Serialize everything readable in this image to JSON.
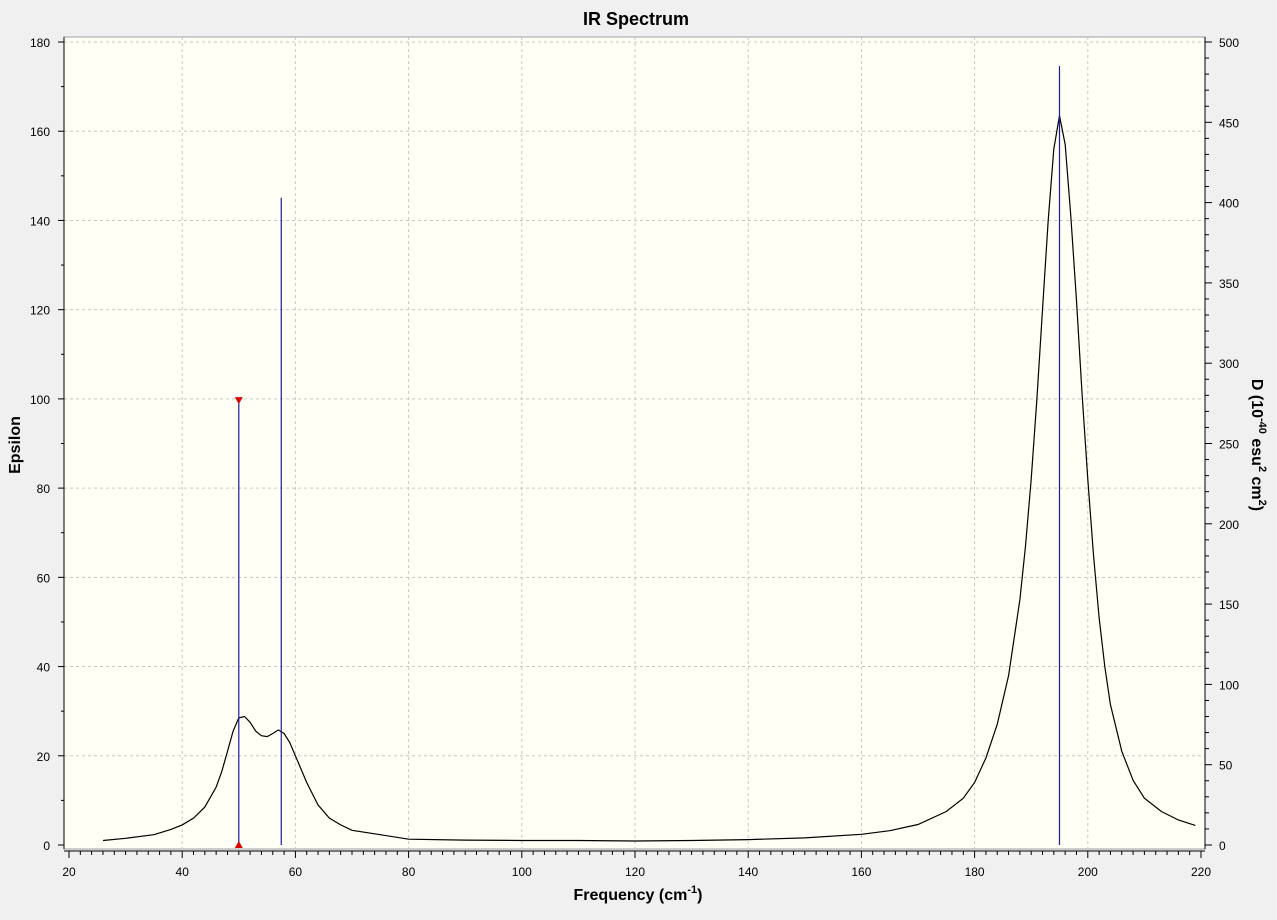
{
  "chart_data": {
    "type": "line",
    "title": "IR Spectrum",
    "xlabel": "Frequency (cm",
    "xlabel_sup": "-1",
    "xlabel_end": ")",
    "ylabel": "Epsilon",
    "y2label_parts": [
      "D (10",
      "-40",
      " esu",
      "2",
      " cm",
      "2",
      ")"
    ],
    "xlim": [
      20,
      220
    ],
    "ylim": [
      0,
      180
    ],
    "y2lim": [
      0,
      500
    ],
    "xticks": [
      20,
      40,
      60,
      80,
      100,
      120,
      140,
      160,
      180,
      200,
      220
    ],
    "yticks": [
      0,
      20,
      40,
      60,
      80,
      100,
      120,
      140,
      160,
      180
    ],
    "y2ticks": [
      0,
      50,
      100,
      150,
      200,
      250,
      300,
      350,
      400,
      450,
      500
    ],
    "grid": true,
    "series": [
      {
        "kind": "spectrum_line",
        "color": "#000000",
        "x": [
          26,
          30,
          35,
          38,
          40,
          42,
          44,
          46,
          47,
          48,
          49,
          50,
          51,
          52,
          53,
          54,
          55,
          56,
          57,
          58,
          59,
          60,
          62,
          64,
          66,
          68,
          70,
          75,
          80,
          90,
          100,
          110,
          120,
          130,
          140,
          150,
          160,
          165,
          170,
          175,
          178,
          180,
          182,
          184,
          186,
          188,
          189,
          190,
          191,
          192,
          193,
          194,
          195,
          196,
          197,
          198,
          199,
          200,
          201,
          202,
          203,
          204,
          206,
          208,
          210,
          213,
          216,
          219
        ],
        "y": [
          1.0,
          1.5,
          2.3,
          3.5,
          4.5,
          6.0,
          8.5,
          13,
          16.5,
          21,
          25.5,
          28.5,
          28.8,
          27.5,
          25.5,
          24.5,
          24.3,
          25.0,
          25.8,
          25.0,
          23.0,
          20.0,
          14.0,
          9.0,
          6.0,
          4.5,
          3.3,
          2.3,
          1.3,
          1.1,
          1.0,
          1.0,
          0.9,
          1.0,
          1.2,
          1.6,
          2.4,
          3.2,
          4.6,
          7.5,
          10.5,
          14,
          19.5,
          27,
          38,
          55,
          67,
          82,
          100,
          120,
          140,
          156,
          163.5,
          157,
          141,
          122,
          101,
          82,
          65,
          51,
          40,
          31.5,
          21,
          14.5,
          10.5,
          7.5,
          5.6,
          4.4
        ]
      },
      {
        "kind": "stick",
        "color": "#1a1aa0",
        "x": [
          50,
          57.5,
          195
        ],
        "y2": [
          277,
          403,
          485
        ]
      }
    ],
    "marker": {
      "x": 50,
      "y2": 277,
      "color": "#dd0000"
    }
  }
}
